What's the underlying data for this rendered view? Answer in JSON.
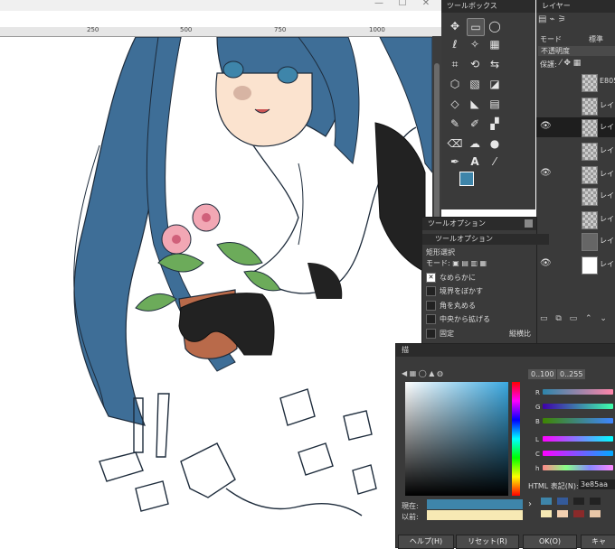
{
  "toolbox": {
    "title": "ツールボックス"
  },
  "layers": {
    "title": "レイヤー",
    "mode_label": "モード",
    "mode_value": "標準",
    "opacity_label": "不透明度",
    "lock_label": "保護:",
    "items": [
      {
        "name": "E805",
        "visible": false
      },
      {
        "name": "レイ",
        "visible": false
      },
      {
        "name": "レイ",
        "visible": true
      },
      {
        "name": "レイ",
        "visible": false
      },
      {
        "name": "レイ",
        "visible": true
      },
      {
        "name": "レイ",
        "visible": false
      },
      {
        "name": "レイ",
        "visible": false
      },
      {
        "name": "レイ",
        "visible": false
      },
      {
        "name": "レイ",
        "visible": true
      }
    ]
  },
  "tool_options": {
    "title": "ツールオプション",
    "tab_label": "ツールオプション",
    "section": "矩形選択",
    "mode_label": "モード:",
    "options": [
      "なめらかに",
      "境界をぼかす",
      "角を丸める",
      "中央から拡げる"
    ],
    "fixed_label": "固定",
    "fixed_value": "縦横比"
  },
  "color_dialog": {
    "title": "描",
    "range_100": "0..100",
    "range_255": "0..255",
    "channels": [
      "R",
      "G",
      "B",
      "L",
      "C",
      "h"
    ],
    "html_label": "HTML 表記(N):",
    "html_value": "3e85aa",
    "current_label": "現在:",
    "previous_label": "以前:",
    "help_button": "ヘルプ(H)",
    "reset_button": "リセット(R)",
    "ok_button": "OK(O)",
    "cancel_button": "キャ"
  },
  "ruler": {
    "ticks": [
      "250",
      "500",
      "750",
      "1000"
    ]
  },
  "colors": {
    "accent": "#3e85aa",
    "panel": "#3a3a3a"
  }
}
